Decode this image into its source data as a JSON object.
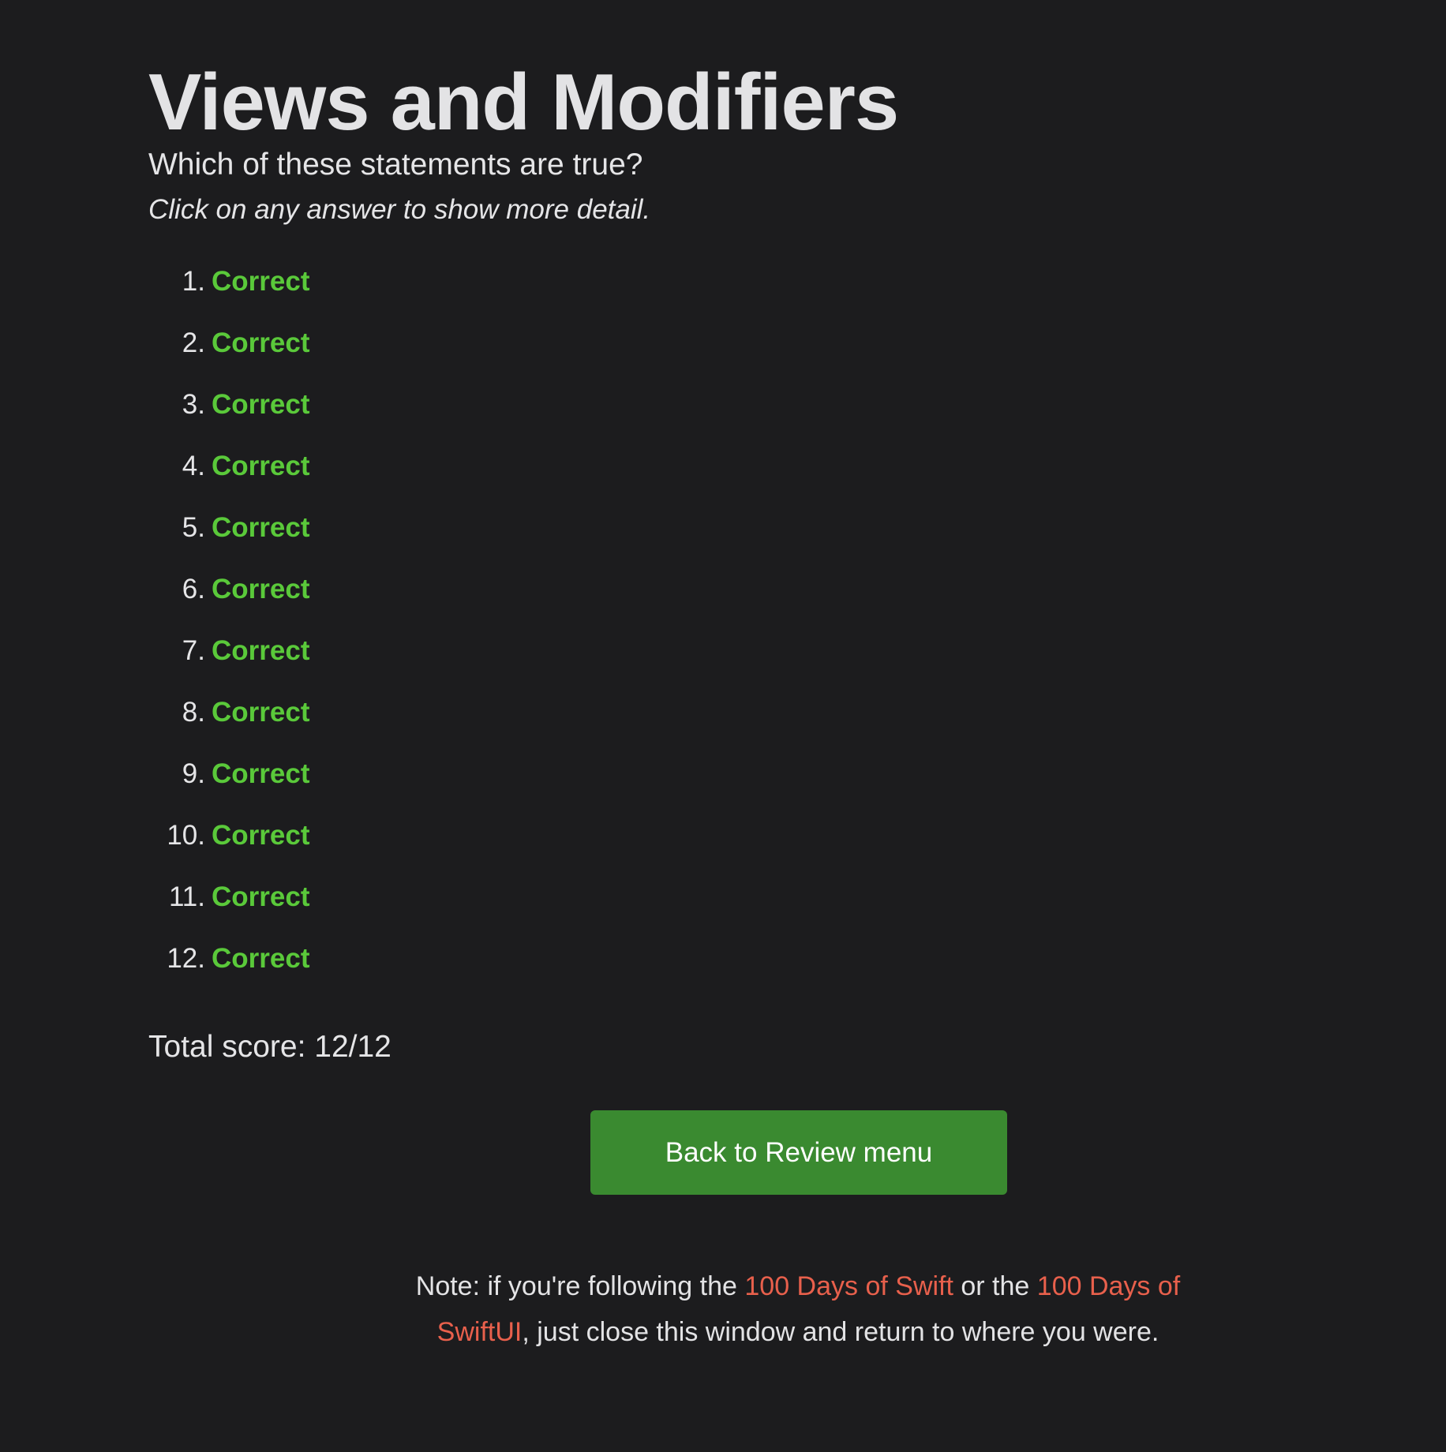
{
  "header": {
    "title": "Views and Modifiers",
    "subtitle": "Which of these statements are true?",
    "hint": "Click on any answer to show more detail."
  },
  "answers": [
    {
      "number": "1.",
      "verdict": "Correct"
    },
    {
      "number": "2.",
      "verdict": "Correct"
    },
    {
      "number": "3.",
      "verdict": "Correct"
    },
    {
      "number": "4.",
      "verdict": "Correct"
    },
    {
      "number": "5.",
      "verdict": "Correct"
    },
    {
      "number": "6.",
      "verdict": "Correct"
    },
    {
      "number": "7.",
      "verdict": "Correct"
    },
    {
      "number": "8.",
      "verdict": "Correct"
    },
    {
      "number": "9.",
      "verdict": "Correct"
    },
    {
      "number": "10.",
      "verdict": "Correct"
    },
    {
      "number": "11.",
      "verdict": "Correct"
    },
    {
      "number": "12.",
      "verdict": "Correct"
    }
  ],
  "score": {
    "text": "Total score: 12/12"
  },
  "actions": {
    "back_label": "Back to Review menu"
  },
  "note": {
    "prefix": "Note: if you're following the ",
    "link1": "100 Days of Swift",
    "middle": " or the ",
    "link2": "100 Days of SwiftUI",
    "suffix": ", just close this window and return to where you were."
  },
  "colors": {
    "background": "#1c1c1e",
    "correct": "#5ac93a",
    "button": "#3a8a30",
    "link": "#e8604c"
  }
}
